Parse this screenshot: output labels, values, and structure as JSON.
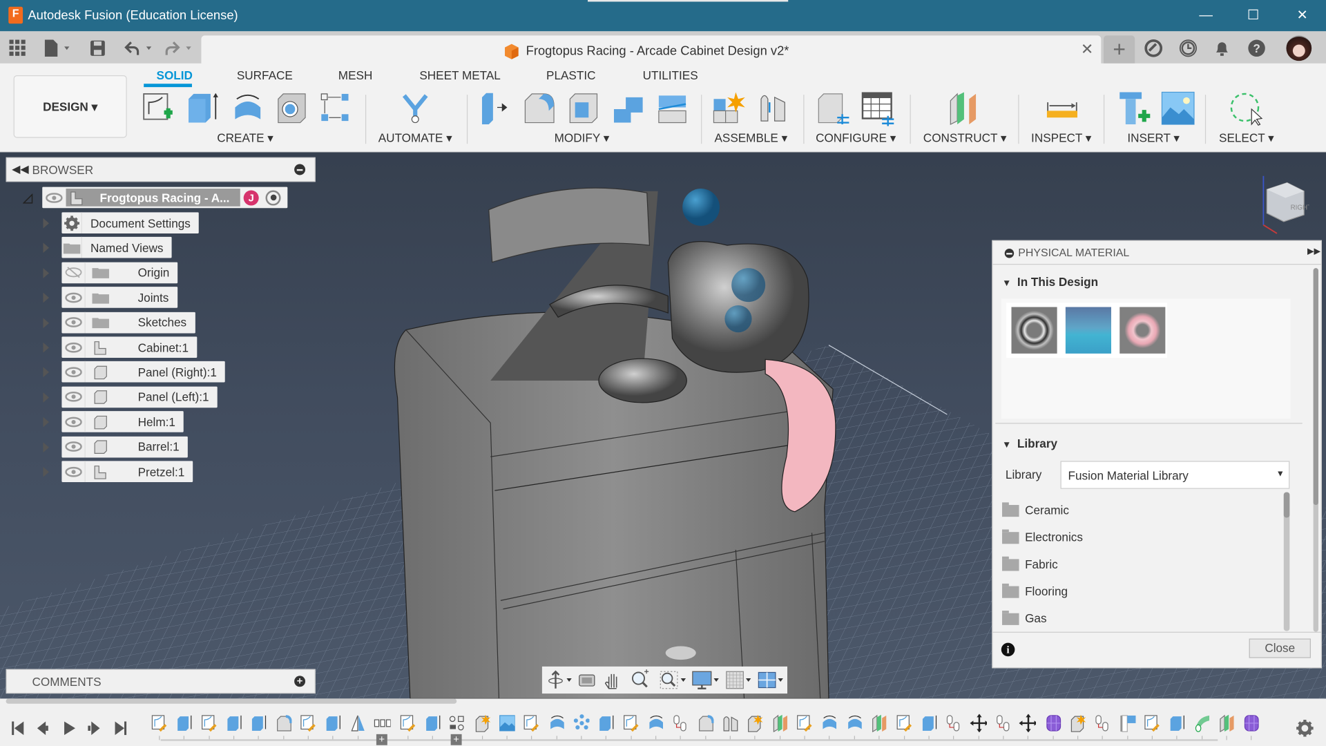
{
  "app": {
    "title": "Autodesk Fusion (Education License)",
    "logo_letter": "F",
    "document_title": "Frogtopus Racing - Arcade Cabinet Design v2*"
  },
  "window_controls": {
    "minimize": "—",
    "maximize": "☐",
    "close": "✕"
  },
  "doc_tab": {
    "close": "✕",
    "new_tab": "+"
  },
  "quick_access": [
    "apps-grid-icon",
    "file-icon",
    "save-icon",
    "undo-icon",
    "redo-icon"
  ],
  "header_icons": [
    "extensions-icon",
    "job-status-icon",
    "notifications-icon",
    "help-icon",
    "user-avatar"
  ],
  "workspace": {
    "label": "DESIGN ▾"
  },
  "ribbon_tabs": [
    {
      "label": "SOLID",
      "active": true
    },
    {
      "label": "SURFACE"
    },
    {
      "label": "MESH"
    },
    {
      "label": "SHEET METAL"
    },
    {
      "label": "PLASTIC"
    },
    {
      "label": "UTILITIES"
    }
  ],
  "ribbon_groups": [
    {
      "label": "CREATE ▾"
    },
    {
      "label": "AUTOMATE ▾"
    },
    {
      "label": "MODIFY ▾"
    },
    {
      "label": "ASSEMBLE ▾"
    },
    {
      "label": "CONFIGURE ▾"
    },
    {
      "label": "CONSTRUCT ▾"
    },
    {
      "label": "INSPECT ▾"
    },
    {
      "label": "INSERT ▾"
    },
    {
      "label": "SELECT ▾"
    }
  ],
  "browser": {
    "title": "BROWSER",
    "root": {
      "label": "Frogtopus Racing - A...",
      "badge": "J"
    },
    "items": [
      {
        "label": "Document Settings",
        "icon": "gear-icon",
        "eye": false
      },
      {
        "label": "Named Views",
        "icon": "folder-icon",
        "eye": false
      },
      {
        "label": "Origin",
        "icon": "folder-icon",
        "eye": "hidden"
      },
      {
        "label": "Joints",
        "icon": "folder-icon",
        "eye": true
      },
      {
        "label": "Sketches",
        "icon": "folder-icon",
        "eye": true
      },
      {
        "label": "Cabinet:1",
        "icon": "component-icon",
        "eye": true
      },
      {
        "label": "Panel (Right):1",
        "icon": "body-icon",
        "eye": true
      },
      {
        "label": "Panel (Left):1",
        "icon": "body-icon",
        "eye": true
      },
      {
        "label": "Helm:1",
        "icon": "body-icon",
        "eye": true
      },
      {
        "label": "Barrel:1",
        "icon": "body-icon",
        "eye": true
      },
      {
        "label": "Pretzel:1",
        "icon": "component-icon",
        "eye": true
      }
    ]
  },
  "comments": {
    "title": "COMMENTS"
  },
  "viewcube": {
    "face": "RIGHT"
  },
  "physical_material": {
    "title": "PHYSICAL MATERIAL",
    "in_design": {
      "title": "In This Design",
      "swatches": [
        {
          "name": "chrome",
          "color": "#8a8a8a"
        },
        {
          "name": "blue-water",
          "color": "#3fb0d0"
        },
        {
          "name": "pink-plastic",
          "color": "#f0b8c4"
        }
      ]
    },
    "library": {
      "title": "Library",
      "label": "Library",
      "selected": "Fusion Material Library",
      "categories": [
        "Ceramic",
        "Electronics",
        "Fabric",
        "Flooring",
        "Gas"
      ]
    },
    "close": "Close"
  },
  "nav_toolbar": [
    "orbit-icon",
    "look-at-icon",
    "pan-icon",
    "zoom-icon",
    "zoom-window-icon",
    "display-settings-icon",
    "grid-icon",
    "viewports-icon"
  ],
  "timeline": {
    "controls": [
      "skip-start-icon",
      "step-back-icon",
      "play-icon",
      "step-forward-icon",
      "skip-end-icon"
    ],
    "features": [
      "sketch",
      "extrude",
      "sketch",
      "extrude",
      "extrude",
      "fillet",
      "sketch",
      "extrude",
      "mirror",
      "pattern",
      "sketch",
      "extrude",
      "param",
      "shell",
      "canvas",
      "sketch",
      "revolve",
      "points",
      "extrude",
      "sketch",
      "revolve",
      "joint",
      "fillet",
      "rigid",
      "shell",
      "plane",
      "sketch",
      "revolve",
      "revolve",
      "plane",
      "sketch",
      "extrude",
      "joint",
      "move",
      "joint",
      "move",
      "form",
      "shell",
      "joint",
      "flag",
      "sketch",
      "extrude",
      "sweep",
      "plane",
      "form"
    ]
  },
  "colors": {
    "titlebar": "#256b8a",
    "accent": "#0696d7",
    "viewport_top": "#36404f",
    "viewport_bottom": "#4c586a"
  }
}
